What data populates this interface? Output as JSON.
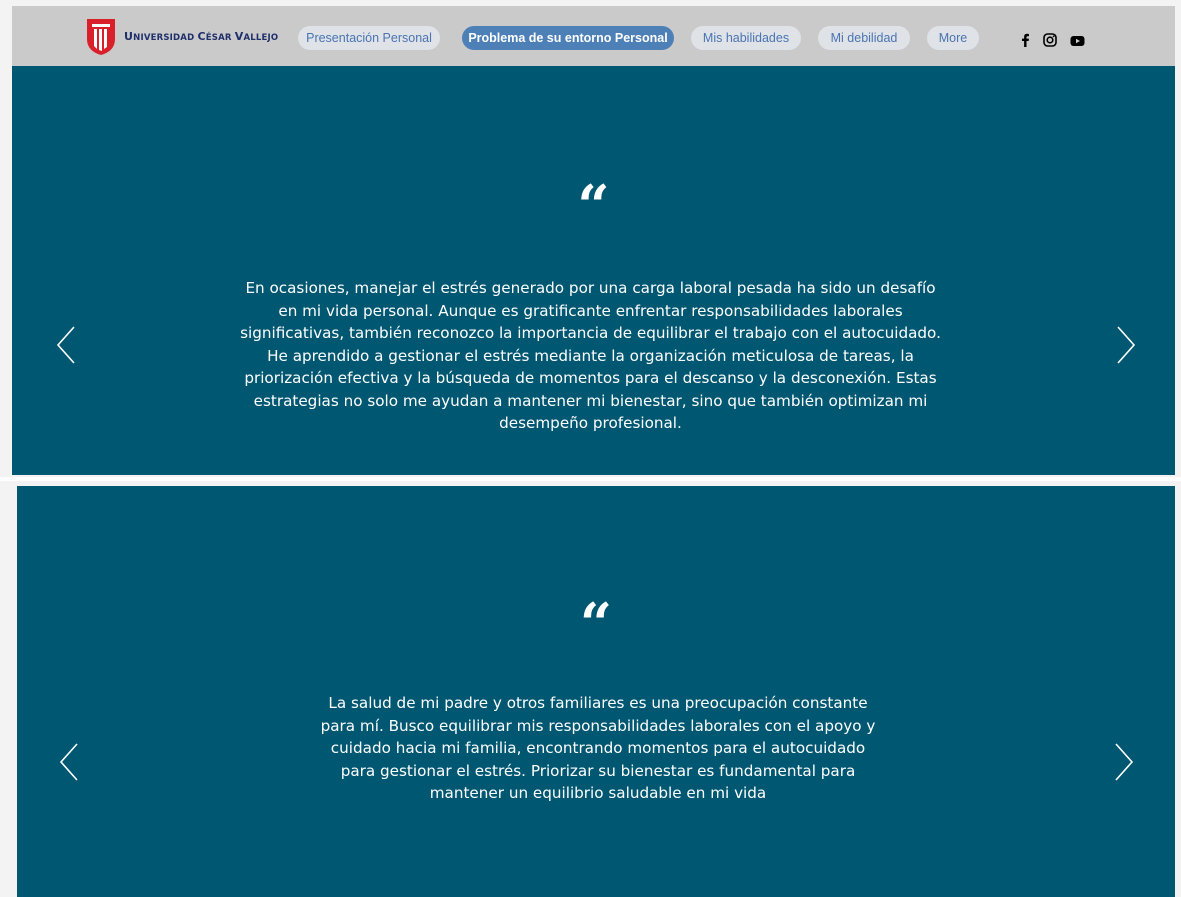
{
  "header": {
    "logo": {
      "name": "Universidad César Vallejo",
      "text_large_1": "U",
      "text_small_1": "NIVERSIDAD ",
      "text_large_2": "C",
      "text_small_2": "ÉSAR ",
      "text_large_3": "V",
      "text_small_3": "ALLEJO",
      "brand_color": "#d91f2a"
    },
    "nav": [
      {
        "label": "Presentación Personal",
        "active": false
      },
      {
        "label": "Problema de su entorno Personal",
        "active": true
      },
      {
        "label": "Mis habilidades",
        "active": false
      },
      {
        "label": "Mi debilidad",
        "active": false
      },
      {
        "label": "More",
        "active": false
      }
    ],
    "social": [
      "facebook-icon",
      "instagram-icon",
      "youtube-icon"
    ]
  },
  "slides": [
    {
      "quote_mark": "“",
      "text": "En ocasiones, manejar el estrés generado por una carga laboral pesada ha sido un desafío en mi vida personal. Aunque es gratificante enfrentar responsabilidades laborales significativas, también reconozco la importancia de equilibrar el trabajo con el autocuidado. He aprendido a gestionar el estrés mediante la organización meticulosa de tareas, la priorización efectiva y la búsqueda de momentos para el descanso y la desconexión. Estas estrategias no solo me ayudan a mantener mi bienestar, sino que también optimizan mi desempeño profesional."
    },
    {
      "quote_mark": "“",
      "text": "La salud de mi padre y otros familiares es una preocupación constante para mí. Busco equilibrar mis responsabilidades laborales con el apoyo y cuidado hacia mi familia, encontrando momentos para el autocuidado para gestionar el estrés. Priorizar su bienestar es fundamental para mantener un equilibrio saludable en mi vida"
    }
  ],
  "colors": {
    "header_bg": "#c9cac9",
    "slide_bg": "#005772",
    "nav_active_bg": "#4e80b8",
    "nav_bg": "#dfe2e6",
    "nav_text": "#4a74b4"
  }
}
